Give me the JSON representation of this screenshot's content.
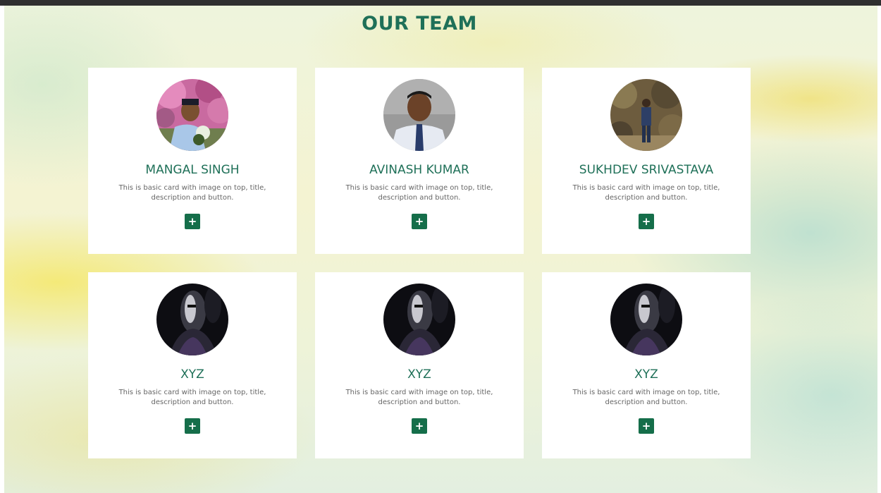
{
  "page": {
    "title": "OUR TEAM"
  },
  "colors": {
    "accent": "#1f7058",
    "button": "#156e4a",
    "card_background": "#ffffff",
    "description_text": "#666666"
  },
  "team": [
    {
      "name": "MANGAL SINGH",
      "description": "This is basic card with image on top, title, description and button.",
      "photo": "photo-man-flowers"
    },
    {
      "name": "AVINASH KUMAR",
      "description": "This is basic card with image on top, title, description and button.",
      "photo": "photo-man-shirt-tie"
    },
    {
      "name": "SUKHDEV SRIVASTAVA",
      "description": "This is basic card with image on top, title, description and button.",
      "photo": "photo-man-outdoors"
    },
    {
      "name": "XYZ",
      "description": "This is basic card with image on top, title, description and button.",
      "photo": "photo-dark-placeholder"
    },
    {
      "name": "XYZ",
      "description": "This is basic card with image on top, title, description and button.",
      "photo": "photo-dark-placeholder"
    },
    {
      "name": "XYZ",
      "description": "This is basic card with image on top, title, description and button.",
      "photo": "photo-dark-placeholder"
    }
  ],
  "icons": {
    "add_button": "plus-icon"
  }
}
